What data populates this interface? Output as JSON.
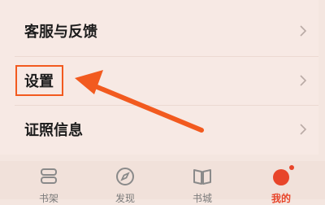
{
  "menu": {
    "items": [
      {
        "label": "客服与反馈"
      },
      {
        "label": "设置"
      },
      {
        "label": "证照信息"
      }
    ]
  },
  "tabbar": {
    "tabs": [
      {
        "label": "书架",
        "icon": "bookshelf-icon"
      },
      {
        "label": "发现",
        "icon": "compass-icon"
      },
      {
        "label": "书城",
        "icon": "book-icon"
      },
      {
        "label": "我的",
        "icon": "profile-icon"
      }
    ],
    "active_index": 3
  },
  "colors": {
    "accent": "#e8452a",
    "annotation": "#f25a1f",
    "background": "#f4e6e0"
  }
}
